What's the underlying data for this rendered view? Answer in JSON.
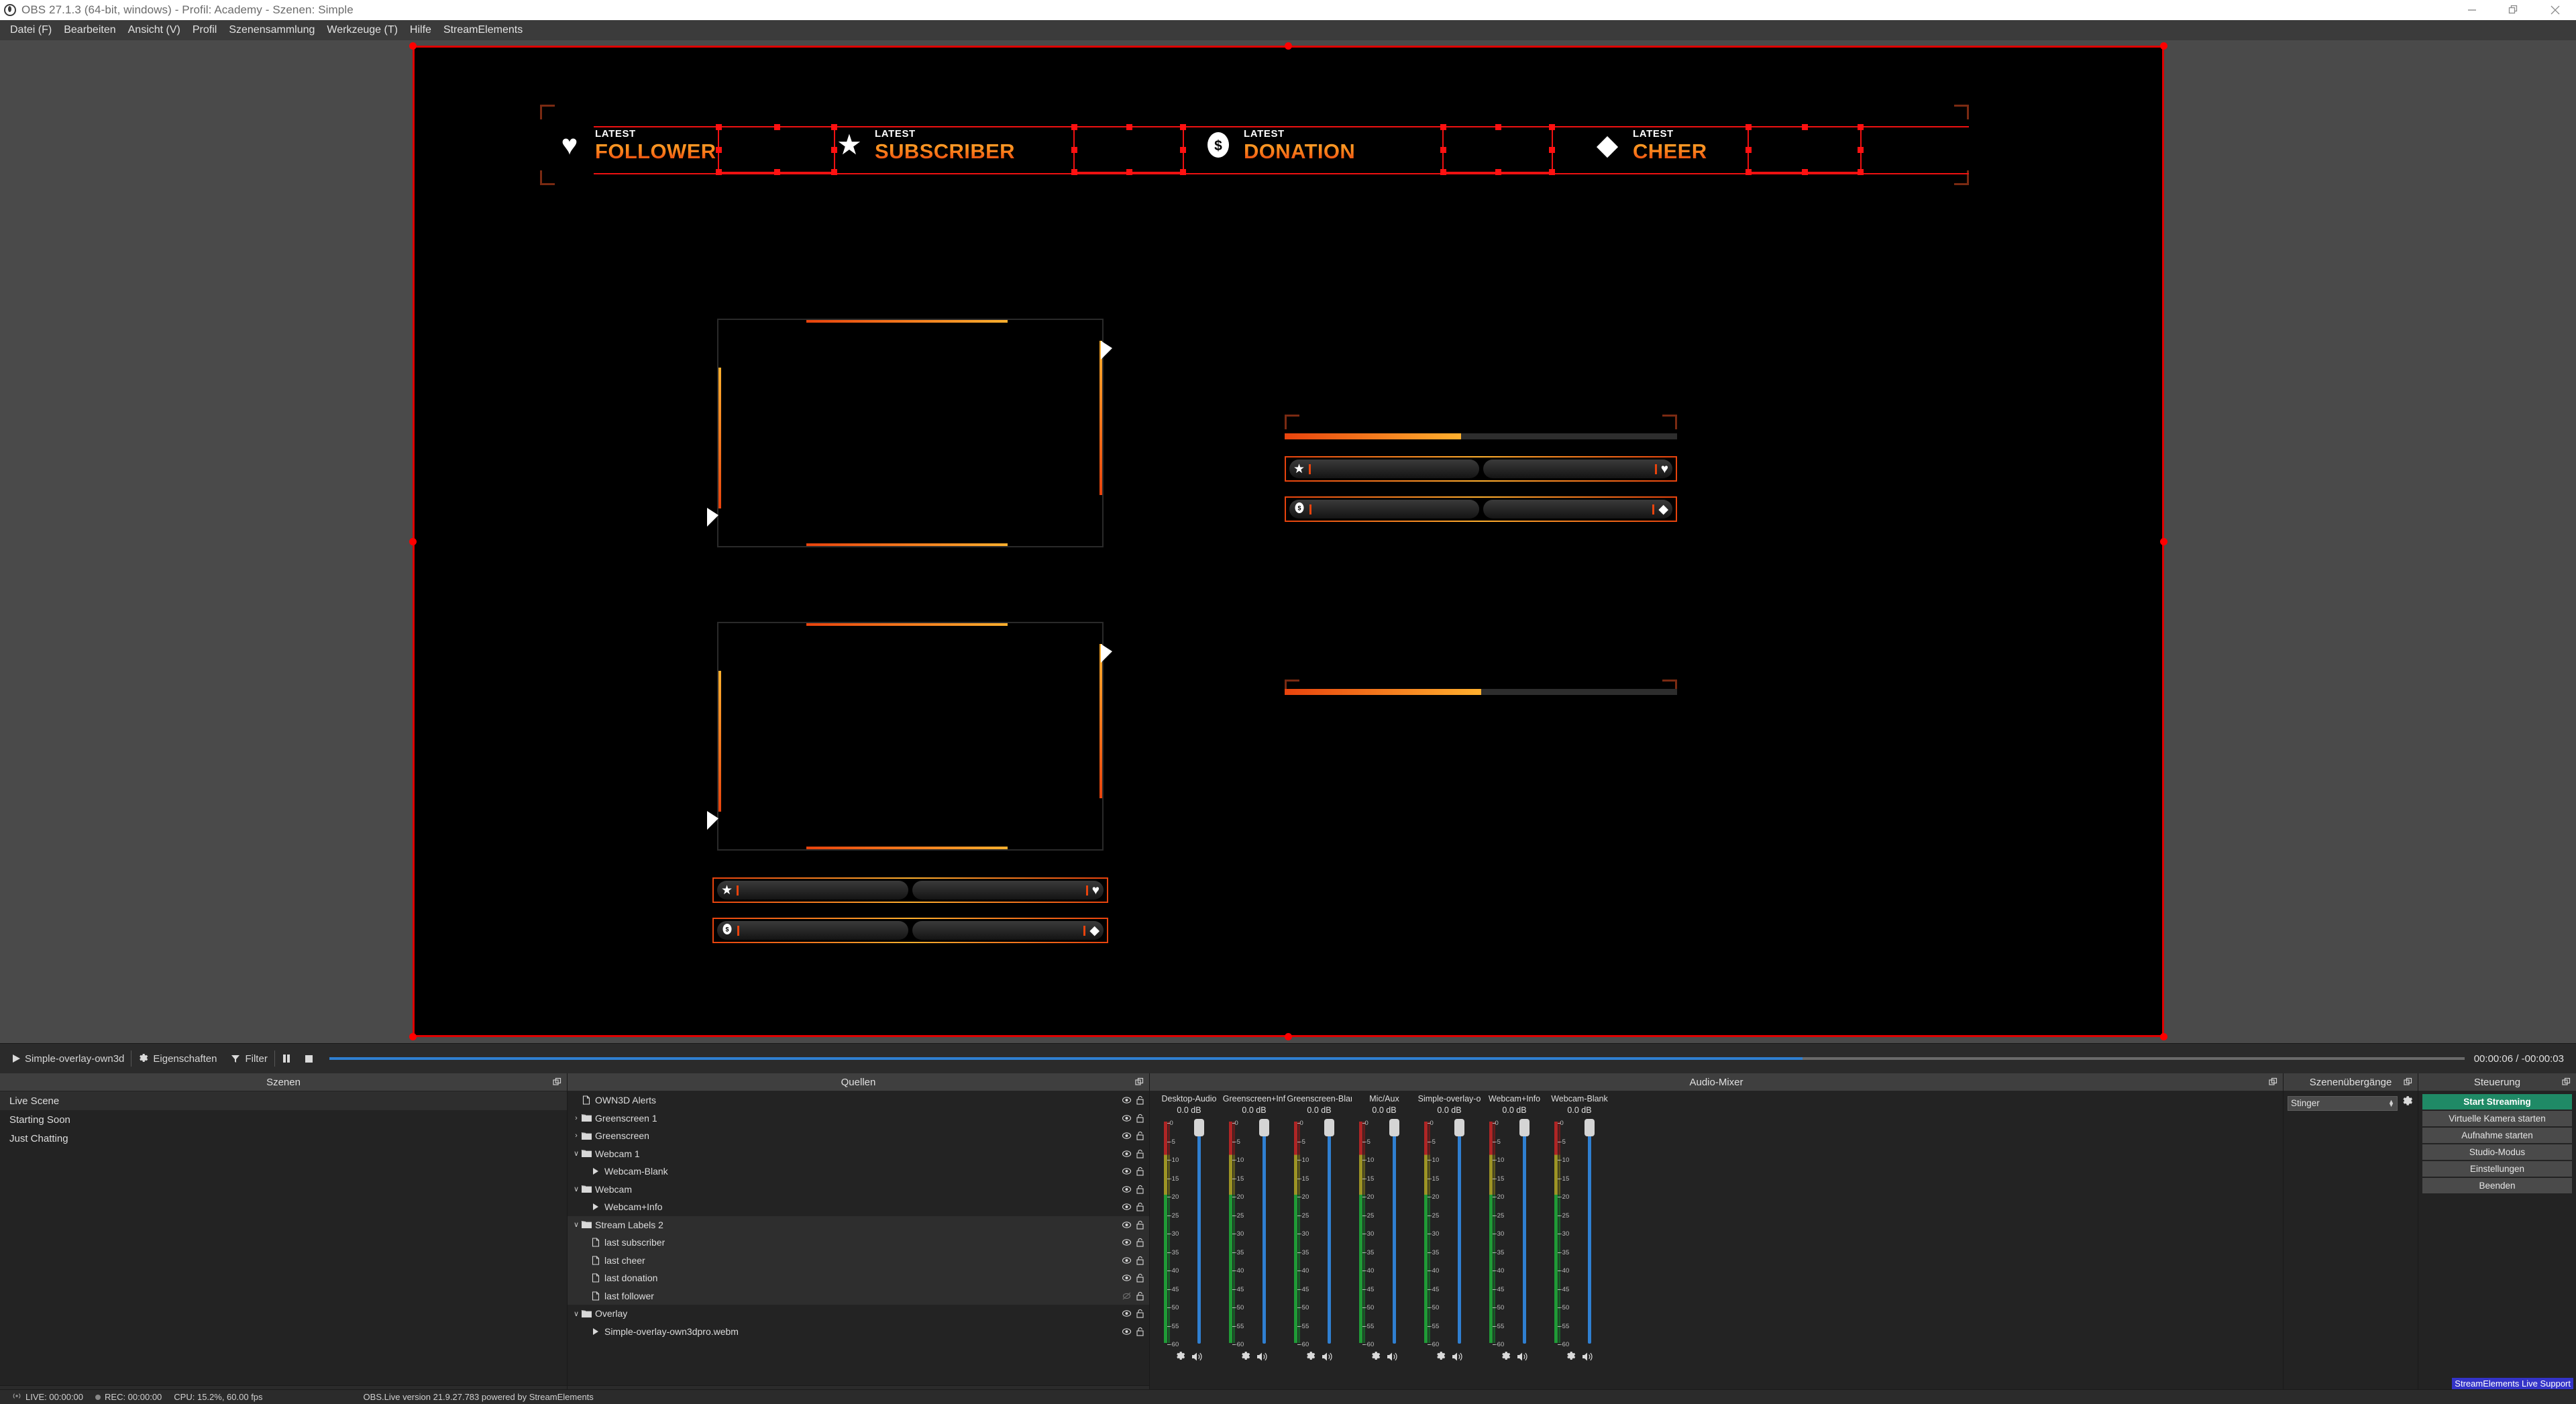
{
  "window": {
    "title": "OBS 27.1.3 (64-bit, windows) - Profil: Academy - Szenen: Simple",
    "minimize_label": "Minimieren",
    "restore_label": "Wiederherstellen",
    "close_label": "Schließen"
  },
  "menu": {
    "items": [
      "Datei (F)",
      "Bearbeiten",
      "Ansicht (V)",
      "Profil",
      "Szenensammlung",
      "Werkzeuge (T)",
      "Hilfe",
      "StreamElements"
    ]
  },
  "preview": {
    "stream_labels": [
      {
        "icon": "heart-icon",
        "glyph": "♥",
        "top": "LATEST",
        "main": "FOLLOWER"
      },
      {
        "icon": "star-icon",
        "glyph": "★",
        "top": "LATEST",
        "main": "SUBSCRIBER"
      },
      {
        "icon": "dollar-coin-icon",
        "glyph": "$",
        "top": "LATEST",
        "main": "DONATION"
      },
      {
        "icon": "diamond-icon",
        "glyph": "♦",
        "top": "LATEST",
        "main": "CHEER"
      }
    ],
    "info_rows": [
      {
        "left_icon": "star-icon",
        "left_glyph": "★",
        "right_icon": "heart-icon",
        "right_glyph": "♥"
      },
      {
        "left_icon": "dollar-coin-icon",
        "left_glyph": "$",
        "right_icon": "diamond-icon",
        "right_glyph": "♦"
      }
    ],
    "progress_fill_percent": 45,
    "accent_orange": "#ff8a1e",
    "accent_red": "#e8430d",
    "selection_color": "#ee1111"
  },
  "source_toolbar": {
    "source_name": "Simple-overlay-own3d",
    "properties_label": "Eigenschaften",
    "filters_label": "Filter",
    "play_icon": "play-icon",
    "pause_icon": "pause-icon",
    "stop_icon": "stop-icon",
    "timecode": "00:00:06 / -00:00:03",
    "seek_percent": 69
  },
  "scenes": {
    "title": "Szenen",
    "items": [
      {
        "label": "Live Scene",
        "selected": true
      },
      {
        "label": "Starting Soon",
        "selected": false
      },
      {
        "label": "Just Chatting",
        "selected": false
      }
    ],
    "footer": {
      "add": "+",
      "remove": "−",
      "up": "∧",
      "down": "∨"
    }
  },
  "sources": {
    "title": "Quellen",
    "items": [
      {
        "label": "OWN3D Alerts",
        "icon": "file-icon",
        "indent": 0,
        "twisty": "",
        "visible": true,
        "locked": false,
        "selected": false
      },
      {
        "label": "Greenscreen 1",
        "icon": "folder-icon",
        "indent": 0,
        "twisty": "›",
        "visible": true,
        "locked": false,
        "selected": false
      },
      {
        "label": "Greenscreen",
        "icon": "folder-icon",
        "indent": 0,
        "twisty": "›",
        "visible": true,
        "locked": false,
        "selected": false
      },
      {
        "label": "Webcam 1",
        "icon": "folder-icon",
        "indent": 0,
        "twisty": "∨",
        "visible": true,
        "locked": false,
        "selected": false
      },
      {
        "label": "Webcam-Blank",
        "icon": "play-icon",
        "indent": 1,
        "twisty": "",
        "visible": true,
        "locked": false,
        "selected": false
      },
      {
        "label": "Webcam",
        "icon": "folder-icon",
        "indent": 0,
        "twisty": "∨",
        "visible": true,
        "locked": false,
        "selected": false
      },
      {
        "label": "Webcam+Info",
        "icon": "play-icon",
        "indent": 1,
        "twisty": "",
        "visible": true,
        "locked": false,
        "selected": false
      },
      {
        "label": "Stream Labels 2",
        "icon": "folder-icon",
        "indent": 0,
        "twisty": "∨",
        "visible": true,
        "locked": false,
        "selected": true
      },
      {
        "label": "last subscriber",
        "icon": "file-icon",
        "indent": 1,
        "twisty": "",
        "visible": true,
        "locked": false,
        "selected": true
      },
      {
        "label": "last cheer",
        "icon": "file-icon",
        "indent": 1,
        "twisty": "",
        "visible": true,
        "locked": false,
        "selected": true
      },
      {
        "label": "last donation",
        "icon": "file-icon",
        "indent": 1,
        "twisty": "",
        "visible": true,
        "locked": false,
        "selected": true
      },
      {
        "label": "last follower",
        "icon": "file-icon",
        "indent": 1,
        "twisty": "",
        "visible": false,
        "locked": false,
        "selected": true
      },
      {
        "label": "Overlay",
        "icon": "folder-icon",
        "indent": 0,
        "twisty": "∨",
        "visible": true,
        "locked": false,
        "selected": false
      },
      {
        "label": "Simple-overlay-own3dpro.webm",
        "icon": "play-icon",
        "indent": 1,
        "twisty": "",
        "visible": true,
        "locked": false,
        "selected": false
      }
    ],
    "footer": {
      "add": "+",
      "remove": "−",
      "settings": "⚙",
      "up": "∧",
      "down": "∨"
    }
  },
  "mixer": {
    "title": "Audio-Mixer",
    "scale_ticks": [
      "0",
      "-5",
      "-10",
      "-15",
      "-20",
      "-25",
      "-30",
      "-35",
      "-40",
      "-45",
      "-50",
      "-55",
      "-60"
    ],
    "channels": [
      {
        "name": "Desktop-Audio",
        "db": "0.0 dB",
        "muted": false
      },
      {
        "name": "Greenscreen+Inf",
        "db": "0.0 dB",
        "muted": false
      },
      {
        "name": "Greenscreen-Blar",
        "db": "0.0 dB",
        "muted": false
      },
      {
        "name": "Mic/Aux",
        "db": "0.0 dB",
        "muted": false
      },
      {
        "name": "Simple-overlay-o",
        "db": "0.0 dB",
        "muted": false
      },
      {
        "name": "Webcam+Info",
        "db": "0.0 dB",
        "muted": false
      },
      {
        "name": "Webcam-Blank",
        "db": "0.0 dB",
        "muted": false
      }
    ]
  },
  "transitions": {
    "title": "Szenenübergänge",
    "selected": "Stinger",
    "settings_icon": "gear-icon"
  },
  "controls": {
    "title": "Steuerung",
    "buttons": [
      {
        "label": "Start Streaming",
        "primary": true
      },
      {
        "label": "Virtuelle Kamera starten",
        "primary": false
      },
      {
        "label": "Aufnahme starten",
        "primary": false
      },
      {
        "label": "Studio-Modus",
        "primary": false
      },
      {
        "label": "Einstellungen",
        "primary": false
      },
      {
        "label": "Beenden",
        "primary": false
      }
    ],
    "primary_color": "#1f8a66"
  },
  "status": {
    "live": "LIVE: 00:00:00",
    "rec": "REC: 00:00:00",
    "cpu": "CPU: 15.2%, 60.00 fps",
    "version": "OBS.Live version 21.9.27.783 powered by StreamElements",
    "se_support": "StreamElements Live Support"
  }
}
